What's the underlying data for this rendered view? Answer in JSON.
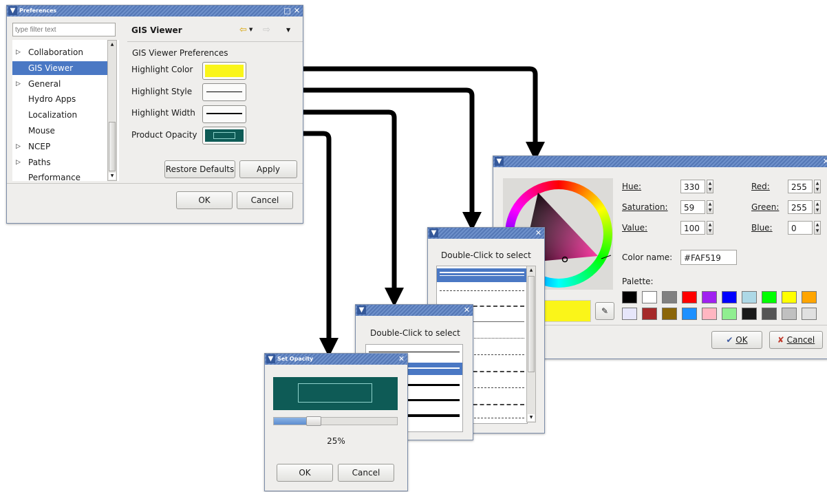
{
  "preferences": {
    "title": "Preferences",
    "filter_placeholder": "type filter text",
    "tree_items": [
      {
        "label": "Collaboration",
        "expandable": true,
        "selected": false
      },
      {
        "label": "GIS Viewer",
        "expandable": false,
        "selected": true
      },
      {
        "label": "General",
        "expandable": true,
        "selected": false
      },
      {
        "label": "Hydro Apps",
        "expandable": false,
        "selected": false
      },
      {
        "label": "Localization",
        "expandable": false,
        "selected": false
      },
      {
        "label": "Mouse",
        "expandable": false,
        "selected": false
      },
      {
        "label": "NCEP",
        "expandable": true,
        "selected": false
      },
      {
        "label": "Paths",
        "expandable": true,
        "selected": false
      },
      {
        "label": "Performance",
        "expandable": false,
        "selected": false
      }
    ],
    "page_title": "GIS Viewer",
    "section_label": "GIS Viewer Preferences",
    "rows": {
      "highlight_color": "Highlight Color",
      "highlight_style": "Highlight Style",
      "highlight_width": "Highlight Width",
      "product_opacity": "Product Opacity"
    },
    "colors": {
      "highlight": "#FAF519",
      "opacity_fill": "#0E5B56"
    },
    "restore_defaults": "Restore Defaults",
    "apply": "Apply",
    "ok": "OK",
    "cancel": "Cancel"
  },
  "color_dialog": {
    "hue_label": "Hue:",
    "hue_value": "330",
    "saturation_label": "Saturation:",
    "saturation_value": "59",
    "value_label": "Value:",
    "value_value": "100",
    "red_label": "Red:",
    "red_value": "255",
    "green_label": "Green:",
    "green_value": "255",
    "blue_label": "Blue:",
    "blue_value": "0",
    "color_name_label": "Color name:",
    "color_name_value": "#FAF519",
    "palette_label": "Palette:",
    "palette_colors": [
      "#000000",
      "#ffffff",
      "#808080",
      "#ff0000",
      "#a020f0",
      "#0000ff",
      "#add8e6",
      "#00ff00",
      "#ffff00",
      "#ffa500",
      "#e6e6fa",
      "#a52a2a",
      "#8b6508",
      "#1e90ff",
      "#ffb6c1",
      "#90ee90",
      "#1a1a1a",
      "#555555",
      "#c0c0c0",
      "#e0e0e0"
    ],
    "ok": "OK",
    "cancel": "Cancel"
  },
  "style_dialog": {
    "prompt": "Double-Click to select"
  },
  "width_dialog": {
    "prompt": "Double-Click to select"
  },
  "opacity_dialog": {
    "title": "Set Opacity",
    "percent": "25%",
    "level": 0.25,
    "ok": "OK",
    "cancel": "Cancel"
  }
}
